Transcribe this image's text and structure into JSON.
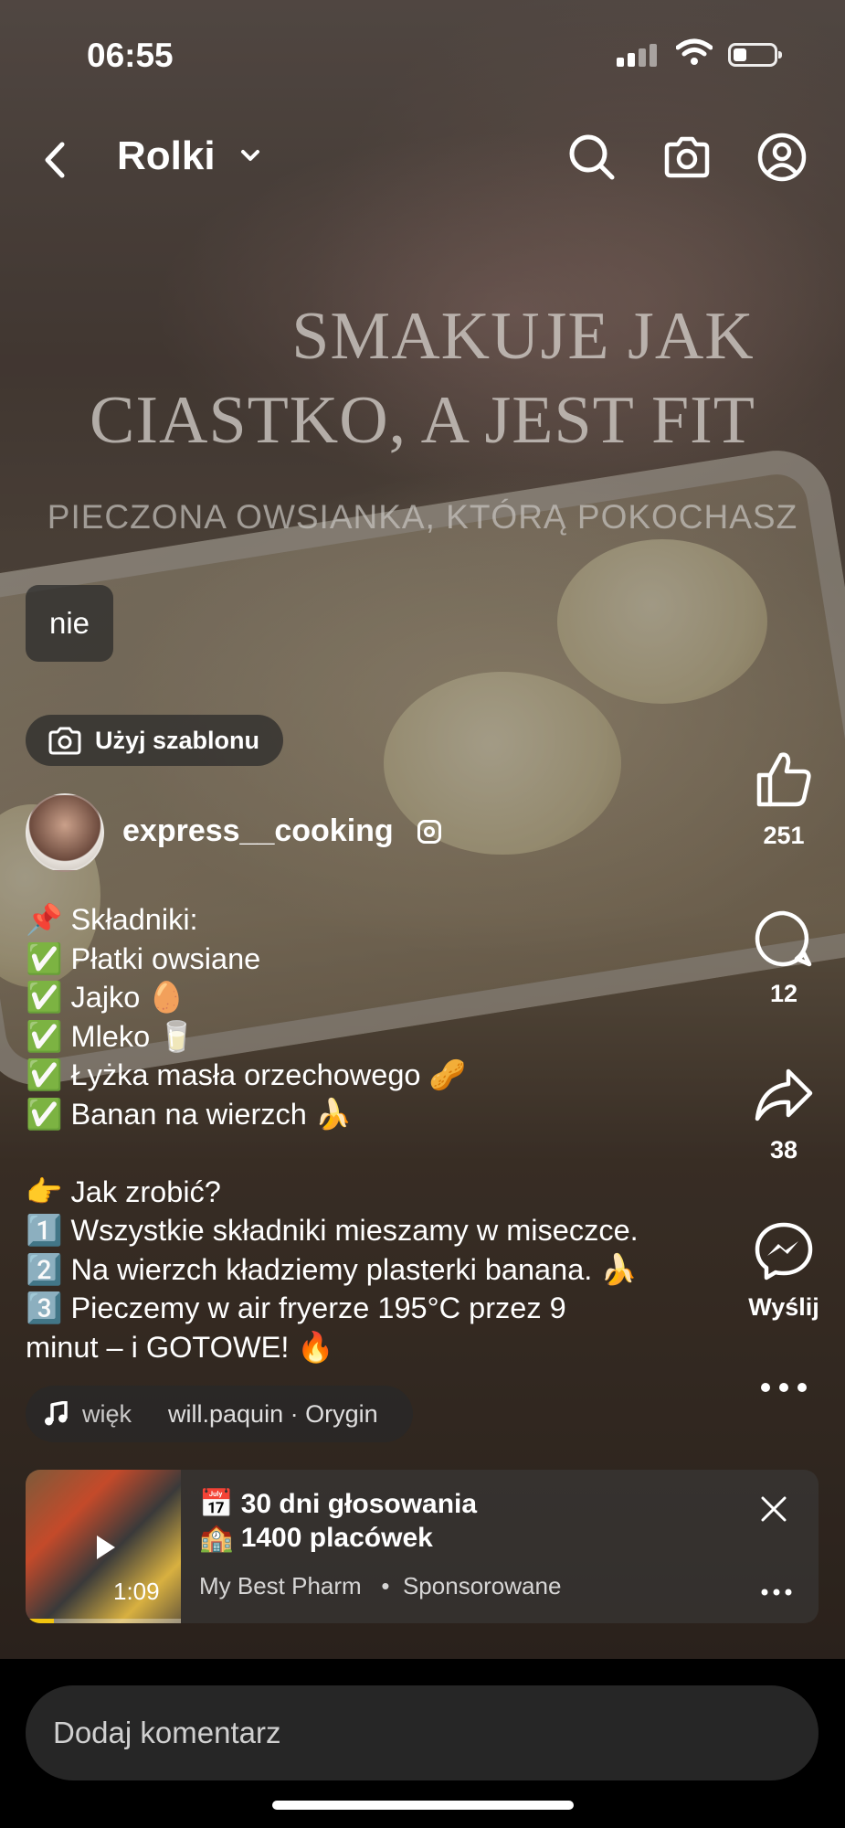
{
  "status_bar": {
    "time": "06:55"
  },
  "header": {
    "title": "Rolki"
  },
  "video_overlay": {
    "line1": "SMAKUJE JAK",
    "line2": "CIASTKO, A JEST FIT",
    "line3": "PIECZONA OWSIANKA, KTÓRĄ POKOCHASZ"
  },
  "comment_bubble": "nie",
  "template_button": "Użyj szablonu",
  "author": {
    "username": "express__cooking"
  },
  "caption_lines": [
    "📌 Składniki:",
    "✅ Płatki owsiane",
    "✅ Jajko 🥚",
    "✅ Mleko 🥛",
    "✅ Łyżka masła orzechowego 🥜",
    "✅ Banan na wierzch 🍌",
    "",
    "👉 Jak zrobić?",
    "1️⃣ Wszystkie składniki mieszamy w miseczce.",
    "2️⃣ Na wierzch kładziemy plasterki banana. 🍌",
    "3️⃣ Pieczemy w air fryerze 195°C przez 9",
    "minut – i GOTOWE! 🔥"
  ],
  "music": {
    "track": "więk",
    "author": "will.paquin · Orygin"
  },
  "actions": {
    "likes": "251",
    "comments": "12",
    "shares": "38",
    "send_label": "Wyślij"
  },
  "ad": {
    "line1": "📅 30 dni głosowania",
    "line2": "🏫 1400 placówek",
    "advertiser": "My Best Pharm",
    "sponsored": "Sponsorowane",
    "duration": "1:09",
    "progress": 0.18
  },
  "comment_input": {
    "placeholder": "Dodaj komentarz"
  },
  "icons": [
    "back-arrow-icon",
    "chevron-down-icon",
    "search-icon",
    "camera-icon",
    "profile-icon",
    "like-icon",
    "comment-icon",
    "share-icon",
    "messenger-icon",
    "more-icon",
    "music-note-icon",
    "close-icon",
    "play-icon",
    "instagram-icon"
  ]
}
